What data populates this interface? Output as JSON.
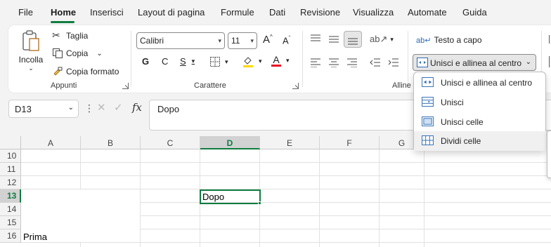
{
  "menu": {
    "tabs": [
      "File",
      "Home",
      "Inserisci",
      "Layout di pagina",
      "Formule",
      "Dati",
      "Revisione",
      "Visualizza",
      "Automate",
      "Guida"
    ],
    "active": "Home"
  },
  "ribbon": {
    "clipboard": {
      "paste_label": "Incolla",
      "cut_label": "Taglia",
      "copy_label": "Copia",
      "format_painter_label": "Copia formato",
      "group_label": "Appunti"
    },
    "font": {
      "font_name": "Calibri",
      "font_size": "11",
      "bold": "G",
      "italic": "C",
      "underline": "S",
      "group_label": "Carattere"
    },
    "alignment": {
      "wrap_text_label": "Testo a capo",
      "merge_center_label": "Unisci e allinea al centro",
      "group_label_partial": "Alline"
    },
    "colors": {
      "accent": "#107c41",
      "font_color": "#e81123",
      "highlight": "#ffd800"
    }
  },
  "formula_bar": {
    "name_box": "D13",
    "fx": "fx",
    "value": "Dopo"
  },
  "grid": {
    "columns": [
      "A",
      "B",
      "C",
      "D",
      "E",
      "F",
      "G"
    ],
    "selected_column": "D",
    "rows": [
      "10",
      "11",
      "12",
      "13",
      "14",
      "15",
      "16"
    ],
    "selected_row": "13",
    "cells": {
      "D13": "Dopo",
      "A16": "Prima"
    }
  },
  "merge_dropdown": {
    "items": [
      {
        "label": "Unisci e allinea al centro",
        "icon": "merge-center-icon"
      },
      {
        "label": "Unisci",
        "icon": "merge-across-icon"
      },
      {
        "label": "Unisci celle",
        "icon": "merge-cells-icon"
      },
      {
        "label": "Dividi celle",
        "icon": "unmerge-cells-icon"
      }
    ],
    "hovered_index": 3
  }
}
